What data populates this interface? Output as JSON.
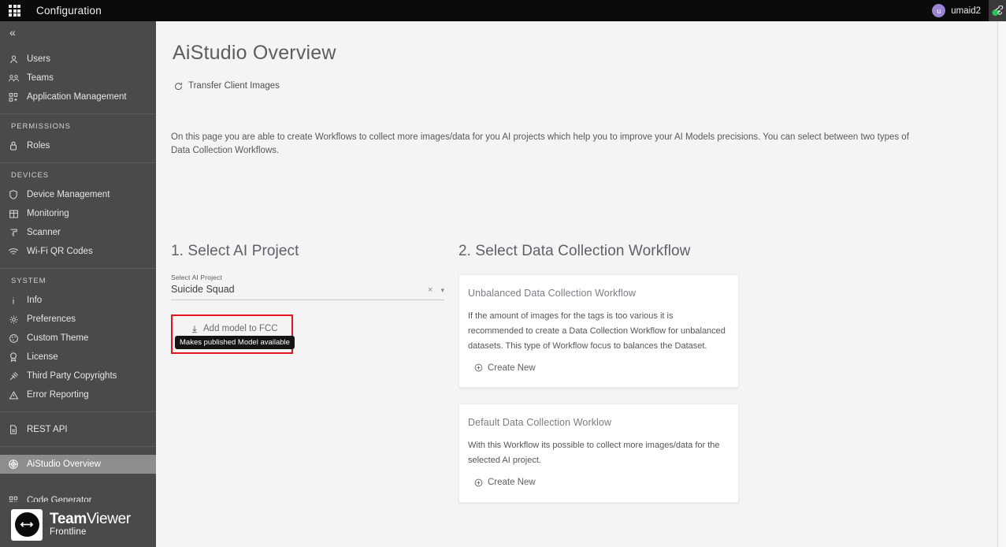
{
  "topbar": {
    "apps_icon": "apps-grid-icon",
    "title": "Configuration",
    "user": {
      "initial": "u",
      "name": "umaid2"
    },
    "connection_icon": "connection-status-icon"
  },
  "sidebar": {
    "collapse_icon": "«",
    "groups": [
      {
        "title": "",
        "items": [
          {
            "label": "Users",
            "icon": "user-icon"
          },
          {
            "label": "Teams",
            "icon": "users-group-icon"
          },
          {
            "label": "Application Management",
            "icon": "apps-management-icon"
          }
        ]
      },
      {
        "title": "PERMISSIONS",
        "items": [
          {
            "label": "Roles",
            "icon": "lock-icon"
          }
        ]
      },
      {
        "title": "DEVICES",
        "items": [
          {
            "label": "Device Management",
            "icon": "shield-icon"
          },
          {
            "label": "Monitoring",
            "icon": "grid-table-icon"
          },
          {
            "label": "Scanner",
            "icon": "scanner-icon"
          },
          {
            "label": "Wi-Fi QR Codes",
            "icon": "wifi-icon"
          }
        ]
      },
      {
        "title": "SYSTEM",
        "items": [
          {
            "label": "Info",
            "icon": "info-icon"
          },
          {
            "label": "Preferences",
            "icon": "gear-icon"
          },
          {
            "label": "Custom Theme",
            "icon": "palette-icon"
          },
          {
            "label": "License",
            "icon": "license-badge-icon"
          },
          {
            "label": "Third Party Copyrights",
            "icon": "gavel-icon"
          },
          {
            "label": "Error Reporting",
            "icon": "warning-triangle-icon"
          }
        ]
      },
      {
        "title": "",
        "items": [
          {
            "label": "REST API",
            "icon": "api-document-icon"
          }
        ]
      },
      {
        "title": "",
        "items": [
          {
            "label": "AiStudio Overview",
            "icon": "aistudio-icon",
            "active": true
          },
          {
            "label": "Code Generator",
            "icon": "qr-code-icon"
          }
        ]
      }
    ],
    "brand": {
      "word_bold": "Team",
      "word_light": "Viewer",
      "subtitle": "Frontline"
    }
  },
  "main": {
    "page_title": "AiStudio Overview",
    "transfer_link": {
      "label": "Transfer Client Images",
      "icon": "refresh-icon"
    },
    "intro": "On this page you are able to create Workflows to collect more images/data for you AI projects which help you to improve your AI Models precisions. You can select between two types of Data Collection Workflows.",
    "step1": {
      "heading": "1. Select AI Project",
      "field_label": "Select AI Project",
      "field_value": "Suicide Squad",
      "clear_icon": "×",
      "caret_icon": "▾",
      "add_model": {
        "label": "Add model to FCC",
        "icon": "download-arrow-icon"
      },
      "tooltip": "Makes published Model available",
      "highlight_color": "#e8161a"
    },
    "step2": {
      "heading": "2. Select Data Collection Workflow",
      "cards": [
        {
          "title": "Unbalanced Data Collection Workflow",
          "body": "If the amount of images for the tags is too various it is recommended to create a Data Collection Workflow for unbalanced datasets. This type of Workflow focus to balances the Dataset.",
          "action": "Create New"
        },
        {
          "title": "Default Data Collection Worklow",
          "body": "With this Workflow its possible to collect more images/data for the selected AI project.",
          "action": "Create New"
        }
      ]
    }
  }
}
